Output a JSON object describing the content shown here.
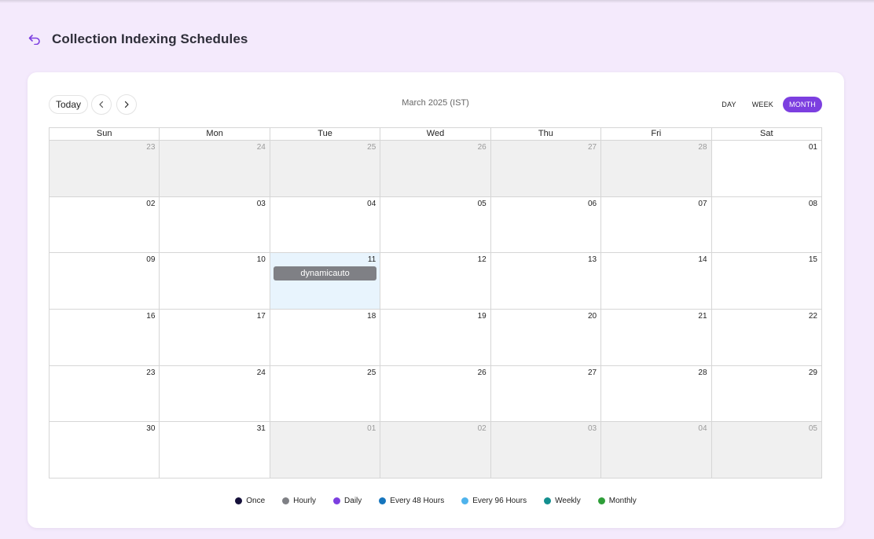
{
  "header": {
    "title": "Collection Indexing Schedules",
    "back_icon": "undo-arrow-icon"
  },
  "toolbar": {
    "today_label": "Today",
    "month_label": "March 2025 (IST)",
    "views": [
      {
        "label": "DAY",
        "active": false
      },
      {
        "label": "WEEK",
        "active": false
      },
      {
        "label": "MONTH",
        "active": true
      }
    ]
  },
  "colors": {
    "accent": "#7c3fe0",
    "event": "#7f8085",
    "today_bg": "#e8f4fd",
    "off_month_bg": "#f0f0f0"
  },
  "calendar": {
    "weekdays": [
      "Sun",
      "Mon",
      "Tue",
      "Wed",
      "Thu",
      "Fri",
      "Sat"
    ],
    "weeks": [
      [
        {
          "d": "23",
          "off": true
        },
        {
          "d": "24",
          "off": true
        },
        {
          "d": "25",
          "off": true
        },
        {
          "d": "26",
          "off": true
        },
        {
          "d": "27",
          "off": true
        },
        {
          "d": "28",
          "off": true
        },
        {
          "d": "01"
        }
      ],
      [
        {
          "d": "02"
        },
        {
          "d": "03"
        },
        {
          "d": "04"
        },
        {
          "d": "05"
        },
        {
          "d": "06"
        },
        {
          "d": "07"
        },
        {
          "d": "08"
        }
      ],
      [
        {
          "d": "09"
        },
        {
          "d": "10"
        },
        {
          "d": "11",
          "today": true,
          "events": [
            "dynamicauto"
          ]
        },
        {
          "d": "12"
        },
        {
          "d": "13"
        },
        {
          "d": "14"
        },
        {
          "d": "15"
        }
      ],
      [
        {
          "d": "16"
        },
        {
          "d": "17"
        },
        {
          "d": "18"
        },
        {
          "d": "19"
        },
        {
          "d": "20"
        },
        {
          "d": "21"
        },
        {
          "d": "22"
        }
      ],
      [
        {
          "d": "23"
        },
        {
          "d": "24"
        },
        {
          "d": "25"
        },
        {
          "d": "26"
        },
        {
          "d": "27"
        },
        {
          "d": "28"
        },
        {
          "d": "29"
        }
      ],
      [
        {
          "d": "30"
        },
        {
          "d": "31"
        },
        {
          "d": "01",
          "off": true
        },
        {
          "d": "02",
          "off": true
        },
        {
          "d": "03",
          "off": true
        },
        {
          "d": "04",
          "off": true
        },
        {
          "d": "05",
          "off": true
        }
      ]
    ]
  },
  "legend": [
    {
      "label": "Once",
      "color": "#15103a"
    },
    {
      "label": "Hourly",
      "color": "#7f8085"
    },
    {
      "label": "Daily",
      "color": "#7c3fe0"
    },
    {
      "label": "Every 48 Hours",
      "color": "#1575bd"
    },
    {
      "label": "Every 96 Hours",
      "color": "#4fb3ec"
    },
    {
      "label": "Weekly",
      "color": "#138f8f"
    },
    {
      "label": "Monthly",
      "color": "#2e9e38"
    }
  ]
}
